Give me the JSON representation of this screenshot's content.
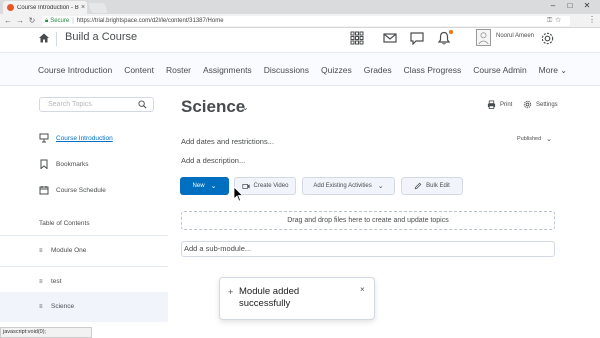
{
  "browser": {
    "tab_title": "Course Introduction - Bu",
    "tab_close": "×",
    "secure_label": "Secure",
    "url": "https://trial.brightspace.com/d2l/le/content/31387/Home"
  },
  "header": {
    "course_title": "Build a Course",
    "user_name": "Noorul Ameen"
  },
  "navbar": {
    "items": [
      "Course Introduction",
      "Content",
      "Roster",
      "Assignments",
      "Discussions",
      "Quizzes",
      "Grades",
      "Class Progress",
      "Course Admin",
      "More"
    ]
  },
  "sidebar": {
    "search_placeholder": "Search Topics",
    "course_intro": "Course Introduction",
    "bookmarks": "Bookmarks",
    "course_schedule": "Course Schedule",
    "toc_label": "Table of Contents",
    "modules": [
      {
        "name": "Module One"
      },
      {
        "name": "test"
      },
      {
        "name": "Science"
      }
    ]
  },
  "main": {
    "heading": "Science",
    "print_label": "Print",
    "settings_label": "Settings",
    "dates_link": "Add dates and restrictions...",
    "status_label": "Published",
    "description_link": "Add a description...",
    "new_button": "New",
    "create_video_button": "Create Video",
    "add_existing_button": "Add Existing Activities",
    "bulk_edit_button": "Bulk Edit",
    "dropzone_text": "Drag and drop files here to create and update topics",
    "submodule_placeholder": "Add a sub-module..."
  },
  "toast": {
    "message": "Module added successfully"
  },
  "statusbar": {
    "text": "javascript:void(0);"
  },
  "colors": {
    "primary": "#006fbf",
    "text": "#494c4e",
    "notification": "#e87511",
    "tab_favicon": "#e8562a"
  }
}
